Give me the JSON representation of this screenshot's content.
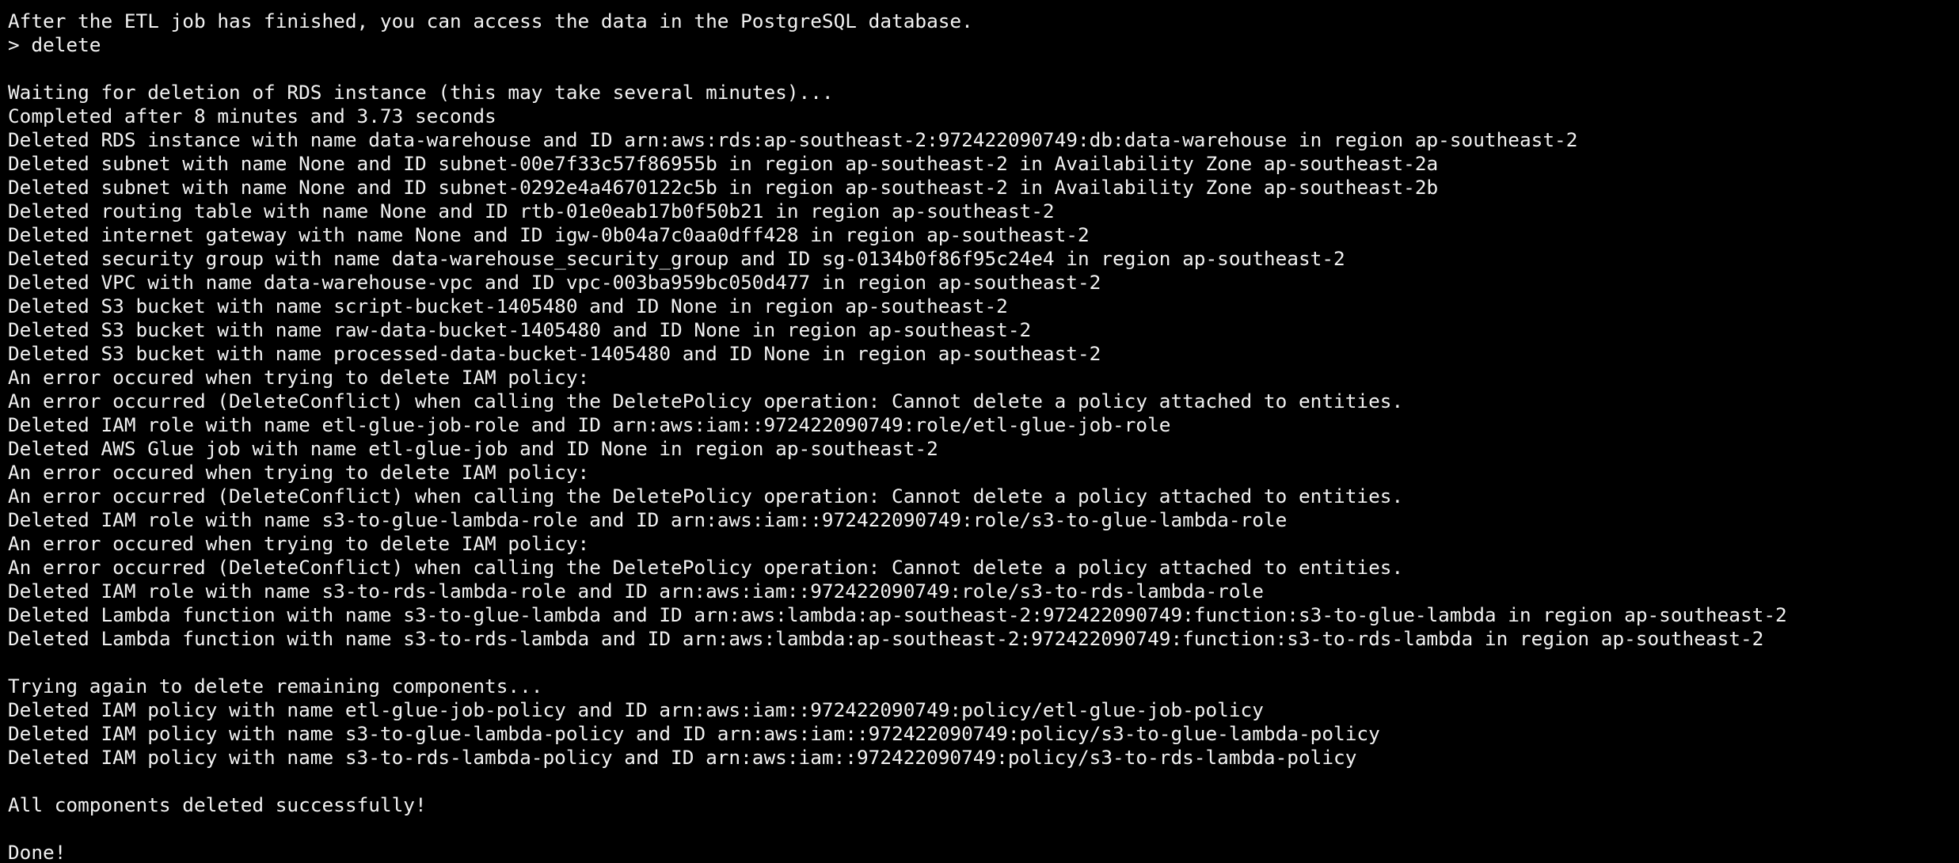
{
  "terminal": {
    "background": "#000000",
    "foreground": "#f2f2f2",
    "lines": [
      "After the ETL job has finished, you can access the data in the PostgreSQL database.",
      "> delete",
      "",
      "Waiting for deletion of RDS instance (this may take several minutes)...",
      "Completed after 8 minutes and 3.73 seconds",
      "Deleted RDS instance with name data-warehouse and ID arn:aws:rds:ap-southeast-2:972422090749:db:data-warehouse in region ap-southeast-2",
      "Deleted subnet with name None and ID subnet-00e7f33c57f86955b in region ap-southeast-2 in Availability Zone ap-southeast-2a",
      "Deleted subnet with name None and ID subnet-0292e4a4670122c5b in region ap-southeast-2 in Availability Zone ap-southeast-2b",
      "Deleted routing table with name None and ID rtb-01e0eab17b0f50b21 in region ap-southeast-2",
      "Deleted internet gateway with name None and ID igw-0b04a7c0aa0dff428 in region ap-southeast-2",
      "Deleted security group with name data-warehouse_security_group and ID sg-0134b0f86f95c24e4 in region ap-southeast-2",
      "Deleted VPC with name data-warehouse-vpc and ID vpc-003ba959bc050d477 in region ap-southeast-2",
      "Deleted S3 bucket with name script-bucket-1405480 and ID None in region ap-southeast-2",
      "Deleted S3 bucket with name raw-data-bucket-1405480 and ID None in region ap-southeast-2",
      "Deleted S3 bucket with name processed-data-bucket-1405480 and ID None in region ap-southeast-2",
      "An error occured when trying to delete IAM policy:",
      "An error occurred (DeleteConflict) when calling the DeletePolicy operation: Cannot delete a policy attached to entities.",
      "Deleted IAM role with name etl-glue-job-role and ID arn:aws:iam::972422090749:role/etl-glue-job-role",
      "Deleted AWS Glue job with name etl-glue-job and ID None in region ap-southeast-2",
      "An error occured when trying to delete IAM policy:",
      "An error occurred (DeleteConflict) when calling the DeletePolicy operation: Cannot delete a policy attached to entities.",
      "Deleted IAM role with name s3-to-glue-lambda-role and ID arn:aws:iam::972422090749:role/s3-to-glue-lambda-role",
      "An error occured when trying to delete IAM policy:",
      "An error occurred (DeleteConflict) when calling the DeletePolicy operation: Cannot delete a policy attached to entities.",
      "Deleted IAM role with name s3-to-rds-lambda-role and ID arn:aws:iam::972422090749:role/s3-to-rds-lambda-role",
      "Deleted Lambda function with name s3-to-glue-lambda and ID arn:aws:lambda:ap-southeast-2:972422090749:function:s3-to-glue-lambda in region ap-southeast-2",
      "Deleted Lambda function with name s3-to-rds-lambda and ID arn:aws:lambda:ap-southeast-2:972422090749:function:s3-to-rds-lambda in region ap-southeast-2",
      "",
      "Trying again to delete remaining components...",
      "Deleted IAM policy with name etl-glue-job-policy and ID arn:aws:iam::972422090749:policy/etl-glue-job-policy",
      "Deleted IAM policy with name s3-to-glue-lambda-policy and ID arn:aws:iam::972422090749:policy/s3-to-glue-lambda-policy",
      "Deleted IAM policy with name s3-to-rds-lambda-policy and ID arn:aws:iam::972422090749:policy/s3-to-rds-lambda-policy",
      "",
      "All components deleted successfully!",
      "",
      "Done!"
    ]
  }
}
